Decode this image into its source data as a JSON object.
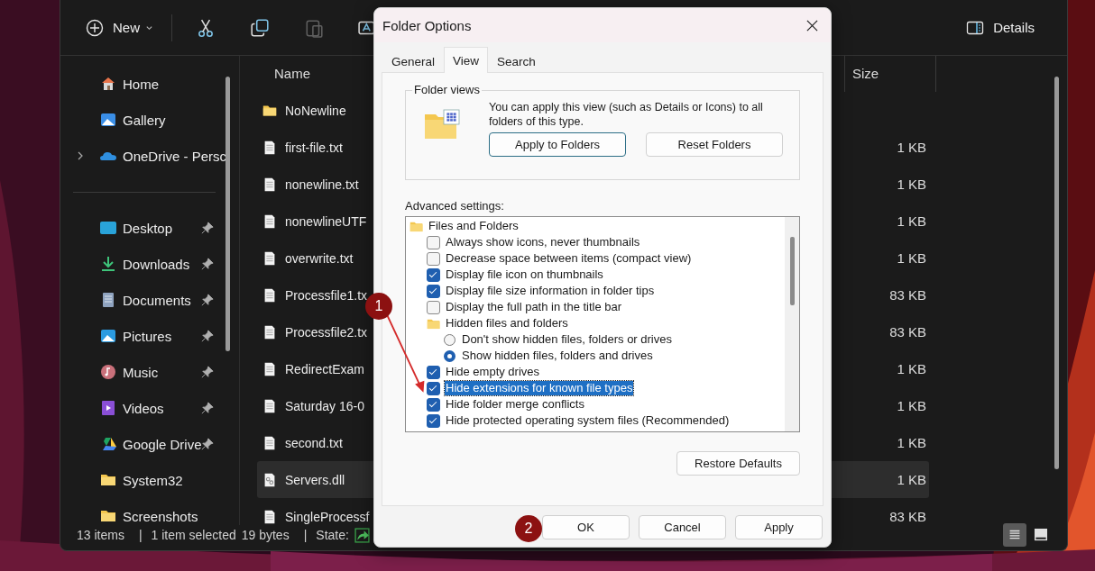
{
  "explorer": {
    "toolbar": {
      "new_label": "New",
      "tools": [
        {
          "kind": "cut",
          "disabled": false
        },
        {
          "kind": "copy",
          "disabled": false
        },
        {
          "kind": "paste",
          "disabled": true
        },
        {
          "kind": "rename",
          "disabled": false
        }
      ],
      "details_label": "Details"
    },
    "sidebar": {
      "groups": [
        [
          {
            "label": "Home",
            "pinned": false,
            "expandable": false
          },
          {
            "label": "Gallery",
            "pinned": false,
            "expandable": false
          },
          {
            "label": "OneDrive - Persc",
            "pinned": false,
            "expandable": true
          }
        ],
        [
          {
            "label": "Desktop",
            "pinned": true,
            "expandable": false
          },
          {
            "label": "Downloads",
            "pinned": true,
            "expandable": false
          },
          {
            "label": "Documents",
            "pinned": true,
            "expandable": false
          },
          {
            "label": "Pictures",
            "pinned": true,
            "expandable": false
          },
          {
            "label": "Music",
            "pinned": true,
            "expandable": false
          },
          {
            "label": "Videos",
            "pinned": true,
            "expandable": false
          },
          {
            "label": "Google Drive",
            "pinned": true,
            "expandable": false
          },
          {
            "label": "System32",
            "pinned": false,
            "expandable": false
          },
          {
            "label": "Screenshots",
            "pinned": false,
            "expandable": false
          }
        ]
      ]
    },
    "file_list": {
      "columns": [
        "Name",
        "Size"
      ],
      "rows": [
        {
          "name": "NoNewline",
          "kind": "folder",
          "size": "",
          "selected": false
        },
        {
          "name": "first-file.txt",
          "kind": "file",
          "size": "1 KB",
          "selected": false
        },
        {
          "name": "nonewline.txt",
          "kind": "file",
          "size": "1 KB",
          "selected": false
        },
        {
          "name": "nonewlineUTF",
          "kind": "file",
          "size": "1 KB",
          "selected": false
        },
        {
          "name": "overwrite.txt",
          "kind": "file",
          "size": "1 KB",
          "selected": false
        },
        {
          "name": "Processfile1.tx",
          "kind": "file",
          "size": "83 KB",
          "selected": false
        },
        {
          "name": "Processfile2.tx",
          "kind": "file",
          "size": "83 KB",
          "selected": false
        },
        {
          "name": "RedirectExam",
          "kind": "file",
          "size": "1 KB",
          "selected": false
        },
        {
          "name": "Saturday 16-0",
          "kind": "file",
          "size": "1 KB",
          "selected": false
        },
        {
          "name": "second.txt",
          "kind": "file",
          "size": "1 KB",
          "selected": false
        },
        {
          "name": "Servers.dll",
          "kind": "dll",
          "size": "1 KB",
          "selected": true
        },
        {
          "name": "SingleProcessf",
          "kind": "file",
          "size": "83 KB",
          "selected": false
        }
      ]
    },
    "status_bar": {
      "parts": [
        {
          "kind": "text",
          "text": "13 items"
        },
        {
          "kind": "separator",
          "text": "|"
        },
        {
          "kind": "text",
          "text": "1 item selected"
        },
        {
          "kind": "text",
          "text": "19 bytes"
        },
        {
          "kind": "separator",
          "text": "|"
        },
        {
          "kind": "state",
          "text": "State:"
        }
      ],
      "view_buttons": [
        {
          "kind": "details",
          "selected": true
        },
        {
          "kind": "tiles",
          "selected": false
        }
      ]
    }
  },
  "dialog": {
    "title": "Folder Options",
    "tabs": [
      {
        "label": "General",
        "selected": false
      },
      {
        "label": "View",
        "selected": true
      },
      {
        "label": "Search",
        "selected": false
      }
    ],
    "folder_views": {
      "legend": "Folder views",
      "text": "You can apply this view (such as Details or Icons) to all folders of this type.",
      "buttons": [
        {
          "label": "Apply to Folders",
          "focused": true
        },
        {
          "label": "Reset Folders",
          "focused": false
        }
      ]
    },
    "advanced_label": "Advanced settings:",
    "advanced_settings": [
      {
        "kind": "folder",
        "label": "Files and Folders",
        "selected": false,
        "children": [
          {
            "kind": "checkbox",
            "label": "Always show icons, never thumbnails",
            "checked": false,
            "selected": false
          },
          {
            "kind": "checkbox",
            "label": "Decrease space between items (compact view)",
            "checked": false,
            "selected": false
          },
          {
            "kind": "checkbox",
            "label": "Display file icon on thumbnails",
            "checked": true,
            "selected": false
          },
          {
            "kind": "checkbox",
            "label": "Display file size information in folder tips",
            "checked": true,
            "selected": false
          },
          {
            "kind": "checkbox",
            "label": "Display the full path in the title bar",
            "checked": false,
            "selected": false
          },
          {
            "kind": "folder",
            "label": "Hidden files and folders",
            "selected": false,
            "children": [
              {
                "kind": "radio",
                "label": "Don't show hidden files, folders or drives",
                "checked": false,
                "selected": false
              },
              {
                "kind": "radio",
                "label": "Show hidden files, folders and drives",
                "checked": true,
                "selected": false
              }
            ]
          },
          {
            "kind": "checkbox",
            "label": "Hide empty drives",
            "checked": true,
            "selected": false
          },
          {
            "kind": "checkbox",
            "label": "Hide extensions for known file types",
            "checked": true,
            "selected": true
          },
          {
            "kind": "checkbox",
            "label": "Hide folder merge conflicts",
            "checked": true,
            "selected": false
          },
          {
            "kind": "checkbox",
            "label": "Hide protected operating system files (Recommended)",
            "checked": true,
            "selected": false
          }
        ]
      }
    ],
    "restore_button": "Restore Defaults",
    "buttons": [
      "OK",
      "Cancel",
      "Apply"
    ]
  },
  "annotations": [
    {
      "label": "1",
      "arrow": true
    },
    {
      "label": "2",
      "arrow": false
    }
  ]
}
